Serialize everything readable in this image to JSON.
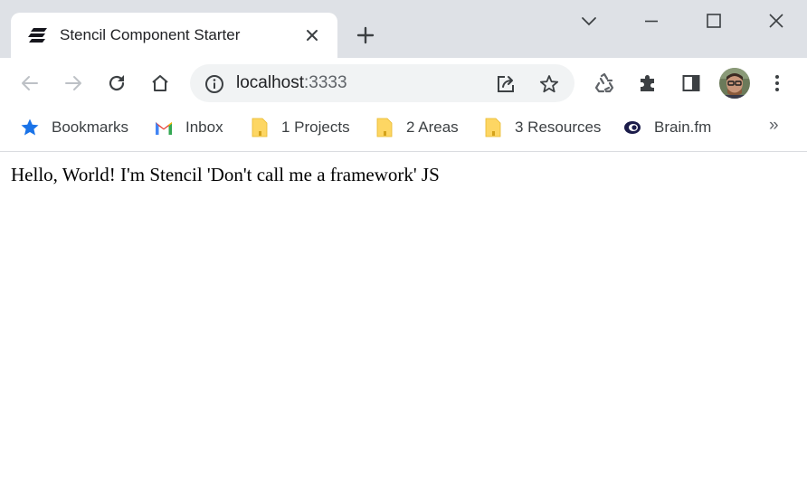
{
  "tab": {
    "title": "Stencil Component Starter"
  },
  "address_bar": {
    "host": "localhost",
    "port": ":3333"
  },
  "bookmarks": [
    {
      "label": "Bookmarks",
      "icon": "star-icon"
    },
    {
      "label": "Inbox",
      "icon": "gmail-icon"
    },
    {
      "label": "1 Projects",
      "icon": "folder-icon"
    },
    {
      "label": "2 Areas",
      "icon": "folder-icon"
    },
    {
      "label": "3 Resources",
      "icon": "folder-icon"
    },
    {
      "label": "Brain.fm",
      "icon": "brainfm-icon"
    }
  ],
  "bookmarks_overflow": "»",
  "page": {
    "text": "Hello, World! I'm Stencil 'Don't call me a framework' JS"
  },
  "colors": {
    "tabstrip_bg": "#dee1e6",
    "omnibox_bg": "#f1f3f4",
    "bookmark_star": "#1a73e8",
    "folder": "#fdd663"
  }
}
